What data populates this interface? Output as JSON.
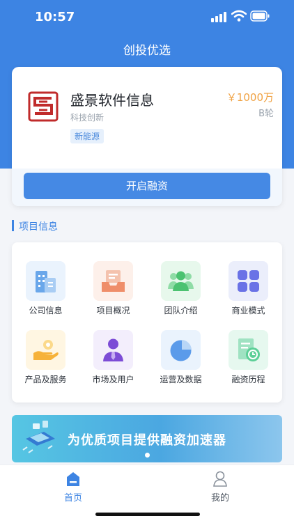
{
  "status_bar": {
    "time": "10:57"
  },
  "nav": {
    "title": "创投优选"
  },
  "company": {
    "name": "盛景软件信息",
    "category": "科技创新",
    "tag": "新能源",
    "amount": "￥1000万",
    "round": "B轮",
    "logo_icon": "company-logo-icon"
  },
  "financing_button": "开启融资",
  "section": {
    "title": "项目信息"
  },
  "grid_items": [
    {
      "label": "公司信息",
      "icon": "building-icon"
    },
    {
      "label": "项目概况",
      "icon": "inbox-icon"
    },
    {
      "label": "团队介绍",
      "icon": "team-icon"
    },
    {
      "label": "商业模式",
      "icon": "apps-icon"
    },
    {
      "label": "产品及服务",
      "icon": "hand-service-icon"
    },
    {
      "label": "市场及用户",
      "icon": "user-tie-icon"
    },
    {
      "label": "运营及数据",
      "icon": "pie-chart-icon"
    },
    {
      "label": "融资历程",
      "icon": "history-doc-icon"
    }
  ],
  "banner": {
    "text": "为优质项目提供融资加速器"
  },
  "tabbar": {
    "items": [
      {
        "label": "首页",
        "icon": "home-icon",
        "active": true
      },
      {
        "label": "我的",
        "icon": "user-icon",
        "active": false
      }
    ]
  },
  "colors": {
    "primary": "#3d84e3",
    "amount": "#f0a243",
    "muted": "#9aa3ad"
  }
}
